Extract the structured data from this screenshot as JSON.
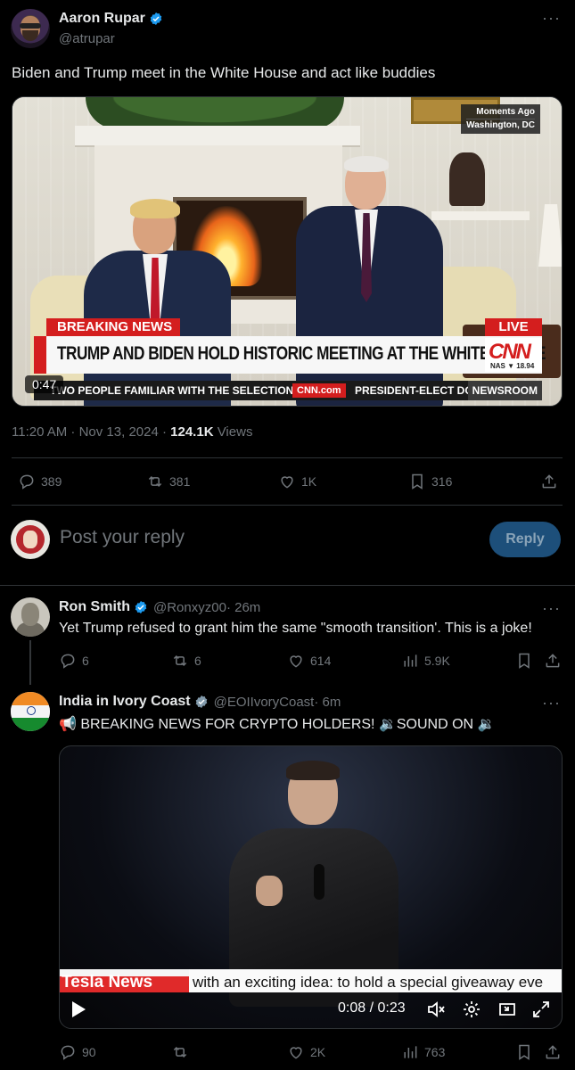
{
  "main_tweet": {
    "author_name": "Aaron Rupar",
    "author_handle": "@atrupar",
    "text": "Biden and Trump meet in the White House and act like buddies",
    "timestamp": "11:20 AM · Nov 13, 2024 · ",
    "views_count": "124.1K",
    "views_label": " Views",
    "video": {
      "duration": "0:47",
      "corner_line1": "Moments Ago",
      "corner_line2": "Washington, DC",
      "breaking_label": "BREAKING NEWS",
      "live_label": "LIVE",
      "headline": "TRUMP AND BIDEN HOLD HISTORIC MEETING AT THE WHITE HOUSE",
      "logo": "CNN",
      "ticker_symbol": "NAS ▼ 18.94",
      "ticker_text": "TWO PEOPLE FAMILIAR WITH THE SELECTION.",
      "ticker_site": "CNN.com",
      "ticker_text2": "PRESIDENT-ELECT DON",
      "ticker_show": "NEWSROOM"
    },
    "stats": {
      "replies": "389",
      "reposts": "381",
      "likes": "1K",
      "bookmarks": "316"
    }
  },
  "reply_box": {
    "placeholder": "Post your reply",
    "button_label": "Reply"
  },
  "replies": [
    {
      "name": "Ron Smith",
      "handle": "@Ronxyz00",
      "time": " · 26m",
      "text": "Yet Trump refused to grant him the same \"smooth transition'. This is a joke!",
      "stats": {
        "replies": "6",
        "reposts": "6",
        "likes": "614",
        "views": "5.9K"
      }
    },
    {
      "name": "India in Ivory Coast",
      "handle": "@EOIIvoryCoast",
      "time": " · 6m",
      "text": "📢 BREAKING NEWS FOR CRYPTO HOLDERS! 🔉SOUND ON 🔉",
      "video": {
        "lower_label": "Tesla News",
        "lower_text": "with an exciting idea: to hold a special giveaway eve",
        "time": "0:08 / 0:23"
      },
      "stats": {
        "replies": "90",
        "reposts": "",
        "likes": "2K",
        "views": "763"
      }
    }
  ],
  "colors": {
    "background": "#000000",
    "text": "#e7e9ea",
    "muted": "#71767b",
    "divider": "#2f3336",
    "verified": "#1d9bf0",
    "reply_button": "#1d4f7a",
    "cnn_red": "#d41e1e"
  }
}
